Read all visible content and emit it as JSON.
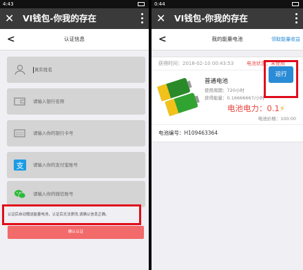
{
  "left": {
    "status_time": "4:43",
    "app_title": "VI钱包-你我的存在",
    "page_title": "认证信息",
    "fields": [
      {
        "placeholder": "真实姓名",
        "icon": "person-icon"
      },
      {
        "placeholder": "请输入银行名称",
        "icon": "bank-icon"
      },
      {
        "placeholder": "请输入你的银行卡号",
        "icon": "card-icon"
      },
      {
        "placeholder": "请输入你的支付宝账号",
        "icon": "alipay-icon"
      },
      {
        "placeholder": "请输入你的微信账号",
        "icon": "wechat-icon"
      }
    ],
    "notice": "认证后自动赠送能量电池，认证后无法更改,请确认信息正确。",
    "confirm_label": "确认认证",
    "colors": {
      "alipay": "#1a9be6",
      "wechat": "#2dbb39",
      "confirm": "#f26a6a",
      "highlight": "#e10b1a"
    }
  },
  "right": {
    "status_time": "0:44",
    "app_title": "VI钱包-你我的存在",
    "page_title": "我的能量电池",
    "nav_link": "领取能量收益",
    "acquired_time": "获得时间：2018-02-10 00:43:53",
    "status_text": "电池状态：未使用",
    "run_label": "运行",
    "battery_name": "普通电池",
    "usage_period": "使用周期：720小时",
    "energy": "获得能量：0.16666667/小时",
    "power_label": "电池电力：",
    "power_value": "0.1",
    "bolt": "⚡",
    "price": "电池价格：100.00",
    "code": "电池编号：H109463364",
    "colors": {
      "run": "#2a8bd6",
      "power": "#e8473e"
    }
  }
}
